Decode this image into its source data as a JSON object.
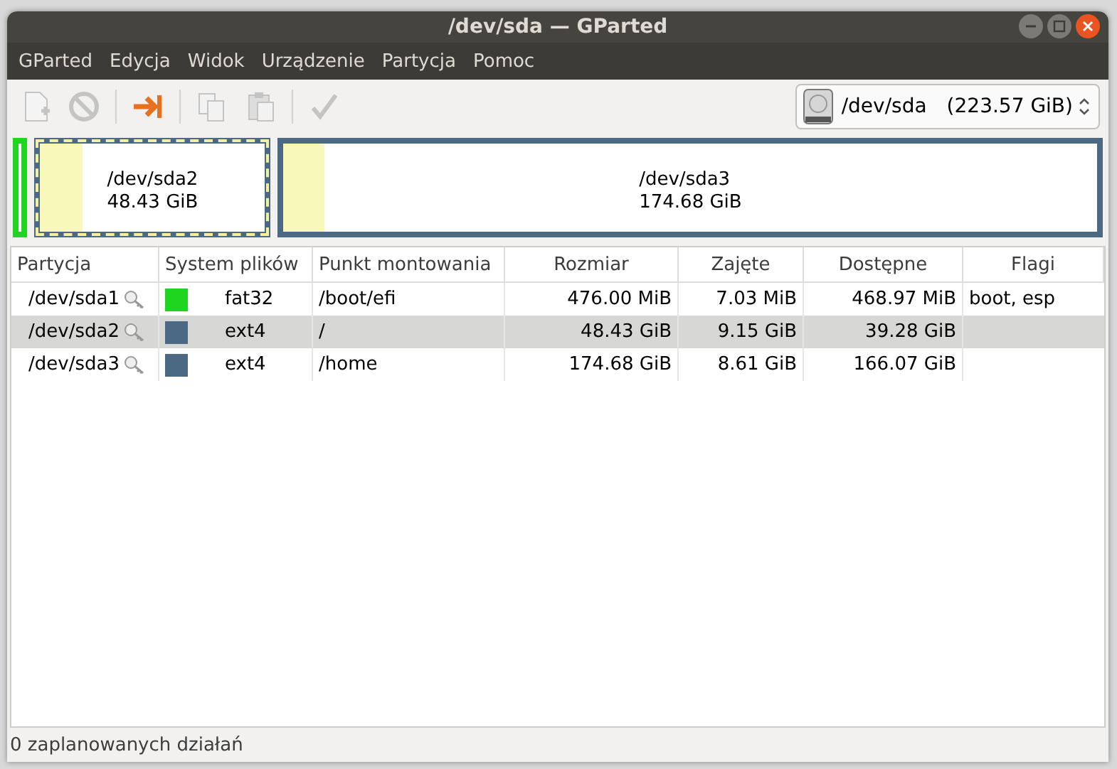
{
  "window": {
    "title": "/dev/sda — GParted"
  },
  "menu": [
    "GParted",
    "Edycja",
    "Widok",
    "Urządzenie",
    "Partycja",
    "Pomoc"
  ],
  "toolbar": [
    {
      "kind": "new",
      "disabled": true
    },
    {
      "kind": "delete",
      "disabled": true
    },
    {
      "kind": "separator"
    },
    {
      "kind": "resize",
      "disabled": false
    },
    {
      "kind": "separator"
    },
    {
      "kind": "copy",
      "disabled": true
    },
    {
      "kind": "paste",
      "disabled": true
    },
    {
      "kind": "separator"
    },
    {
      "kind": "apply",
      "disabled": true
    }
  ],
  "device": {
    "name": "/dev/sda",
    "size": "(223.57 GiB)"
  },
  "disk_map": [
    {
      "color": "#1fd51f",
      "selected": false,
      "kind": "sliver"
    },
    {
      "name": "/dev/sda2",
      "size": "48.43 GiB",
      "color": "#4b6983",
      "level": 0.19,
      "selected": true,
      "kind": "block"
    },
    {
      "name": "/dev/sda3",
      "size": "174.68 GiB",
      "color": "#4b6983",
      "level": 0.05,
      "selected": false,
      "kind": "block"
    }
  ],
  "table": {
    "columns": [
      "Partycja",
      "System plików",
      "Punkt montowania",
      "Rozmiar",
      "Zajęte",
      "Dostępne",
      "Flagi"
    ],
    "rows": [
      {
        "partition": "/dev/sda1",
        "filesystem": "fat32",
        "color": "#1fd51f",
        "mount": "/boot/efi",
        "size": "476.00 MiB",
        "used": "7.03 MiB",
        "free": "468.97 MiB",
        "flags": "boot, esp",
        "selected": false
      },
      {
        "partition": "/dev/sda2",
        "filesystem": "ext4",
        "color": "#4b6983",
        "mount": "/",
        "size": "48.43 GiB",
        "used": "9.15 GiB",
        "free": "39.28 GiB",
        "selected": true
      },
      {
        "partition": "/dev/sda3",
        "filesystem": "ext4",
        "color": "#4b6983",
        "mount": "/home",
        "size": "174.68 GiB",
        "used": "8.61 GiB",
        "free": "166.07 GiB",
        "selected": false
      }
    ]
  },
  "status_bar": "0 zaplanowanych działań"
}
